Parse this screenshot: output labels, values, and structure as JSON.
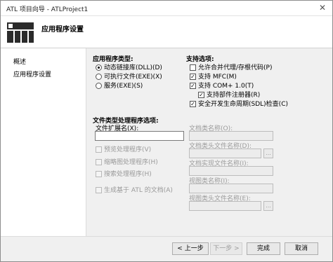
{
  "window": {
    "title": "ATL 项目向导 - ATLProject1",
    "close_glyph": "✕"
  },
  "header": {
    "title": "应用程序设置"
  },
  "sidebar": {
    "items": [
      {
        "label": "概述"
      },
      {
        "label": "应用程序设置"
      }
    ]
  },
  "app_type": {
    "label": "应用程序类型:",
    "options": [
      {
        "label": "动态链接库(DLL)(D)",
        "selected": true
      },
      {
        "label": "可执行文件(EXE)(X)",
        "selected": false
      },
      {
        "label": "服务(EXE)(S)",
        "selected": false
      }
    ]
  },
  "support": {
    "label": "支持选项:",
    "options": [
      {
        "label": "允许合并代理/存根代码(P)",
        "checked": false
      },
      {
        "label": "支持 MFC(M)",
        "checked": true
      },
      {
        "label": "支持 COM+ 1.0(T)",
        "checked": true
      },
      {
        "label": "支持部件注册器(R)",
        "checked": true
      },
      {
        "label": "安全开发生命周期(SDL)检查(C)",
        "checked": true
      }
    ]
  },
  "file_type": {
    "label": "文件类型处理程序选项:",
    "ext_label": "文件扩展名(X):",
    "ext_value": "",
    "checks": [
      {
        "label": "预览处理程序(V)"
      },
      {
        "label": "缩略图处理程序(H)"
      },
      {
        "label": "搜索处理程序(H)"
      },
      {
        "label": "生成基于 ATL 的文档(A)"
      }
    ]
  },
  "doc_fields": [
    {
      "label": "文档类名称(O):",
      "browse": false
    },
    {
      "label": "文档类头文件名称(D):",
      "browse": true
    },
    {
      "label": "文档实现文件名称(I):",
      "browse": false
    },
    {
      "label": "视图类名称(I):",
      "browse": false
    },
    {
      "label": "视图类头文件名称(E):",
      "browse": true
    }
  ],
  "browse_glyph": "...",
  "footer": {
    "prev": "< 上一步",
    "next": "下一步 >",
    "finish": "完成",
    "cancel": "取消"
  },
  "check_glyph": "✓"
}
